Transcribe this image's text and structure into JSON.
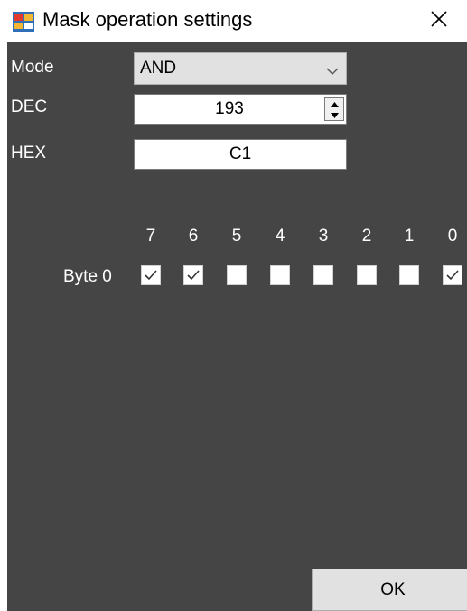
{
  "window": {
    "title": "Mask operation settings",
    "app_icon": "settings-window-icon",
    "close_icon": "close-icon"
  },
  "form": {
    "mode_label": "Mode",
    "mode_value": "AND",
    "dec_label": "DEC",
    "dec_value": "193",
    "hex_label": "HEX",
    "hex_value": "C1"
  },
  "bits": {
    "headers": [
      "7",
      "6",
      "5",
      "4",
      "3",
      "2",
      "1",
      "0"
    ],
    "row_label": "Byte 0",
    "checked": [
      true,
      true,
      false,
      false,
      false,
      false,
      false,
      true
    ]
  },
  "footer": {
    "ok_label": "OK"
  },
  "colors": {
    "panel_background": "#454545",
    "window_background": "#ffffff",
    "label_text": "#ffffff",
    "button_face": "#e1e1e1"
  }
}
